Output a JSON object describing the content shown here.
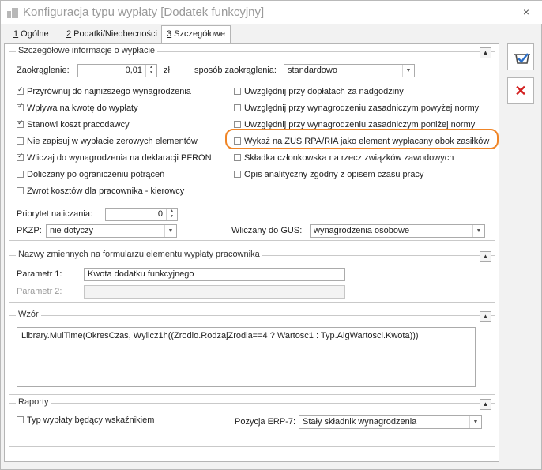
{
  "window": {
    "title": "Konfiguracja typu wypłaty [Dodatek funkcyjny]",
    "close_glyph": "×"
  },
  "tabs": [
    {
      "key": "1",
      "label": " Ogólne"
    },
    {
      "key": "2",
      "label": " Podatki/Nieobecności"
    },
    {
      "key": "3",
      "label": " Szczegółowe"
    }
  ],
  "details": {
    "title": "Szczegółowe informacje o wypłacie",
    "rounding_label": "Zaokrąglenie:",
    "rounding_value": "0,01",
    "currency": "zł",
    "rounding_method_label": "sposób zaokrąglenia:",
    "rounding_method_value": "standardowo",
    "checkboxes_left": [
      {
        "label": "Przyrównuj do najniższego wynagrodzenia",
        "checked": true
      },
      {
        "label": "Wpływa na kwotę do wypłaty",
        "checked": true
      },
      {
        "label": "Stanowi koszt pracodawcy",
        "checked": true
      },
      {
        "label": "Nie zapisuj w wypłacie zerowych elementów",
        "checked": false
      },
      {
        "label": "Wliczaj do wynagrodzenia na deklaracji PFRON",
        "checked": true
      },
      {
        "label": "Doliczany po ograniczeniu potrąceń",
        "checked": false
      },
      {
        "label": "Zwrot kosztów dla pracownika - kierowcy",
        "checked": false
      }
    ],
    "checkboxes_right": [
      {
        "label": "Uwzględnij przy dopłatach za nadgodziny",
        "checked": false
      },
      {
        "label": "Uwzględnij przy wynagrodzeniu zasadniczym powyżej normy",
        "checked": false
      },
      {
        "label": "Uwzględnij przy wynagrodzeniu zasadniczym poniżej normy",
        "checked": false
      },
      {
        "label": "Wykaż na ZUS RPA/RIA jako element wypłacany obok zasiłków",
        "checked": false
      },
      {
        "label": "Składka członkowska na rzecz związków zawodowych",
        "checked": false
      },
      {
        "label": "Opis analityczny zgodny z opisem czasu pracy",
        "checked": false
      }
    ],
    "priority_label": "Priorytet naliczania:",
    "priority_value": "0",
    "pkzp_label": "PKZP:",
    "pkzp_value": "nie dotyczy",
    "gus_label": "Wliczany do GUS:",
    "gus_value": "wynagrodzenia osobowe"
  },
  "variables": {
    "title": "Nazwy zmiennych na formularzu elementu wypłaty pracownika",
    "param1_label": "Parametr 1:",
    "param1_value": "Kwota dodatku funkcyjnego",
    "param2_label": "Parametr 2:",
    "param2_value": ""
  },
  "formula": {
    "title": "Wzór",
    "value": "Library.MulTime(OkresCzas, Wylicz1h((Zrodlo.RodzajZrodla==4 ? Wartosc1 : Typ.AlgWartosci.Kwota)))"
  },
  "reports": {
    "title": "Raporty",
    "indicator_label": "Typ wypłaty będący wskaźnikiem",
    "indicator_checked": false,
    "erp_label": "Pozycja ERP-7:",
    "erp_value": "Stały składnik wynagrodzenia"
  },
  "glyphs": {
    "collapse": "▲",
    "dropdown": "▼",
    "spin_up": "▲",
    "spin_down": "▼",
    "cancel": "✕"
  },
  "colors": {
    "highlight": "#f08526",
    "cancel": "#d32020",
    "save_accent": "#2a6fc9"
  }
}
